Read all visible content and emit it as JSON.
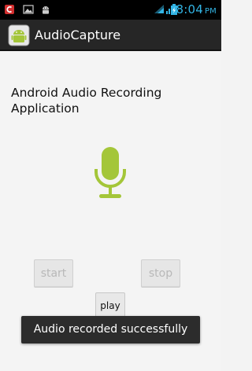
{
  "status_bar": {
    "time": "8:04",
    "ampm": "PM",
    "icons": [
      "notification-app-icon",
      "image-icon",
      "android-icon",
      "wifi-icon",
      "signal-icon",
      "battery-charging-icon"
    ]
  },
  "action_bar": {
    "title": "AudioCapture",
    "app_icon": "android-app-icon"
  },
  "main": {
    "heading": "Android Audio Recording Application",
    "mic_icon": "microphone-icon",
    "mic_color": "#a4c639",
    "buttons": {
      "start": "start",
      "stop": "stop",
      "play": "play"
    }
  },
  "toast": {
    "message": "Audio recorded successfully"
  },
  "colors": {
    "status_accent": "#33b5e5",
    "action_bar_bg": "#262626",
    "background": "#f3f3f3"
  }
}
